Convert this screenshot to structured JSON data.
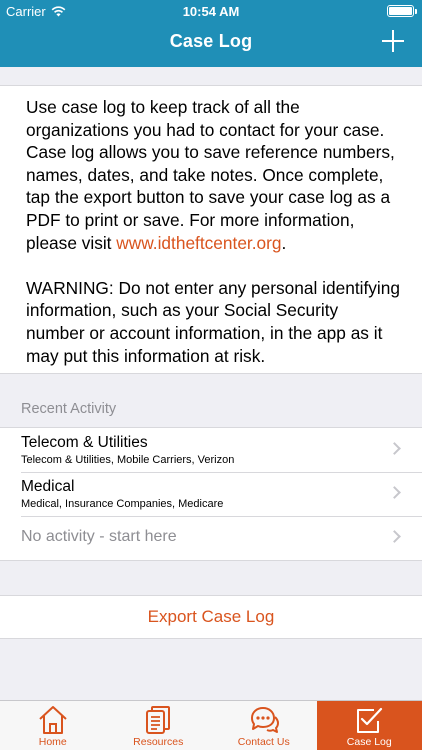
{
  "status_bar": {
    "carrier": "Carrier",
    "time": "10:54 AM"
  },
  "nav": {
    "title": "Case Log",
    "add_icon": "plus-icon"
  },
  "intro": {
    "paragraph_1": "Use case log to keep track of all the organizations you had to contact for your case. Case log allows you to save reference numbers, names, dates, and take notes. Once complete, tap the export button to save your case log as a PDF to print or save. For more information, please visit ",
    "link_text": "www.idtheftcenter.org",
    "paragraph_1_end": ".",
    "warning": "WARNING: Do not enter any personal identifying information, such as your Social Security number or account information, in the app as it may put this information at risk."
  },
  "recent_activity": {
    "header": "Recent Activity",
    "items": [
      {
        "title": "Telecom & Utilities",
        "subtitle": "Telecom & Utilities, Mobile Carriers, Verizon"
      },
      {
        "title": "Medical",
        "subtitle": "Medical, Insurance Companies, Medicare"
      }
    ],
    "empty_label": "No activity - start here"
  },
  "export_label": "Export Case Log",
  "tabs": [
    {
      "label": "Home",
      "icon": "home-icon"
    },
    {
      "label": "Resources",
      "icon": "documents-icon"
    },
    {
      "label": "Contact Us",
      "icon": "chat-bubbles-icon"
    },
    {
      "label": "Case Log",
      "icon": "checklist-icon",
      "active": true
    }
  ],
  "colors": {
    "nav_bar": "#1f8fb7",
    "accent": "#d9541e"
  }
}
